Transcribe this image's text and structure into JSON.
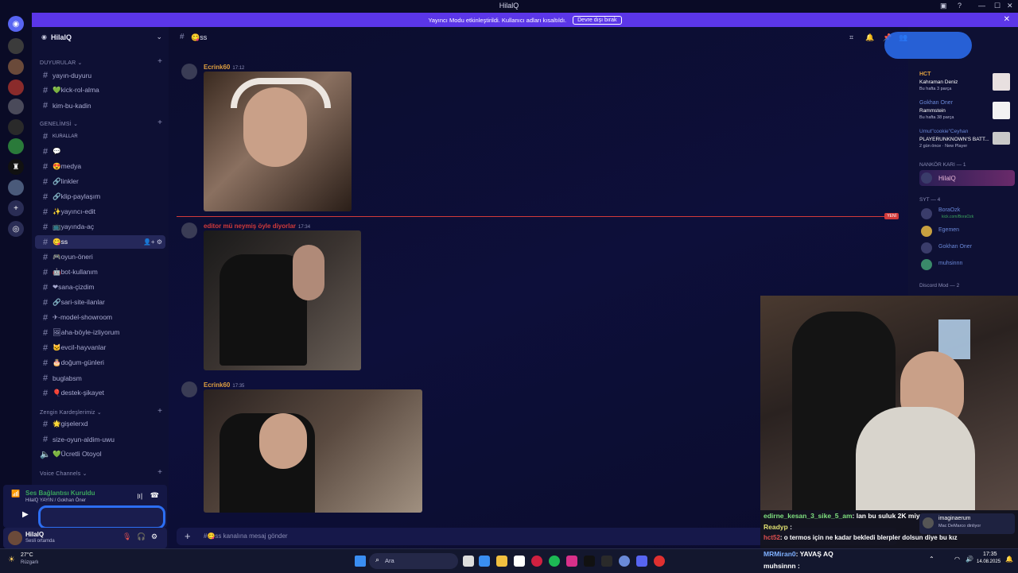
{
  "window": {
    "title": "HilalQ"
  },
  "banner": {
    "text": "Yayıncı Modu etkinleştirildi. Kullanıcı adları kısaltıldı.",
    "button": "Devre dışı bırak"
  },
  "server": {
    "name": "HilalQ"
  },
  "sidebar": {
    "categories": [
      {
        "label": "DUYURULAR ⌄"
      },
      {
        "label": "GENELİMSİ ⌄"
      },
      {
        "label": "Zengin Kardeşlerimiz ⌄"
      },
      {
        "label": "Voice Channels ⌄"
      }
    ],
    "channels": [
      {
        "label": "yayın-duyuru"
      },
      {
        "label": "💚kick-rol-alma"
      },
      {
        "label": "kim-bu-kadin"
      },
      {
        "label": "KURALLAR"
      },
      {
        "label": "💬"
      },
      {
        "label": "😍medya"
      },
      {
        "label": "🔗linkler"
      },
      {
        "label": "🔗klip-paylaşım"
      },
      {
        "label": "✨yayıncı-edit"
      },
      {
        "label": "📺yayında-aç"
      },
      {
        "label": "😋ss"
      },
      {
        "label": "🎮oyun-öneri"
      },
      {
        "label": "🤖bot-kullanım"
      },
      {
        "label": "❤sana-çizdim"
      },
      {
        "label": "🔗sari-site-ilanlar"
      },
      {
        "label": "✈-model-showroom"
      },
      {
        "label": "🖼aha-böyle-izliyorum"
      },
      {
        "label": "🐱evcil-hayvanlar"
      },
      {
        "label": "🎂doğum-günleri"
      },
      {
        "label": "buglabsm"
      },
      {
        "label": "🎈destek-şikayet"
      },
      {
        "label": "🌟gişelerxd"
      },
      {
        "label": "size-oyun-aldim-uwu"
      },
      {
        "label": "💚Ücretli Otoyol"
      }
    ]
  },
  "voice": {
    "status": "Ses Bağlantısı Kuruldu",
    "channel": "HilalQ YAYIN / Gokhan Öner"
  },
  "user": {
    "name": "HilalQ",
    "status": "Sesli ortamda"
  },
  "chat": {
    "channel_title": "😋ss",
    "messages": [
      {
        "author": "Ecrink60",
        "time": "17:12",
        "color": "#e0a040"
      },
      {
        "author": "editor mü neymiş öyle diyorlar",
        "time": "17:34",
        "color": "#d23a3a"
      },
      {
        "author": "Ecrink60",
        "time": "17:35",
        "color": "#e0a040"
      }
    ],
    "new_badge": "YENİ",
    "composer_placeholder": "#😋ss kanalına mesaj gönder"
  },
  "members": {
    "groups": [
      {
        "title": "NANKÖR KARI — 1"
      },
      {
        "title": "SYT — 4"
      },
      {
        "title": "Discord Mod — 2"
      }
    ],
    "activity": [
      {
        "name": "HCT",
        "line1": "Kahraman Deniz",
        "line2": "Bu hafta 3 parça"
      },
      {
        "name": "Gokhan Oner",
        "line1": "Rammstein",
        "line2": "Bu hafta 38 parça"
      },
      {
        "name": "Umut\"cookie\"Ceyhan",
        "line1": "PLAYERUNKNOWN'S BATT...",
        "line2": "2 gün önce · New Player"
      }
    ],
    "users": [
      {
        "name": "HilalQ"
      },
      {
        "name": "BoraOzk",
        "sub": "kick.com/BoraOzk"
      },
      {
        "name": "Egemen"
      },
      {
        "name": "Gokhan Oner"
      },
      {
        "name": "muhsinnn"
      }
    ]
  },
  "stream_chat": [
    {
      "user": "edirne_kesan_3_sike_5_am",
      "text": ": lan bu suluk 2K miydi",
      "color": "#7fe07f"
    },
    {
      "user": "Readyp",
      "text": " :",
      "color": "#e0e070"
    },
    {
      "user": "hct52",
      "text": ": o termos için ne kadar bekledi blerpler dolsun diye bu kız",
      "color": "#e05050"
    },
    {
      "user": "MRMiran0",
      "text": ": YAVAŞ AQ",
      "color": "#7fb0ff"
    },
    {
      "user": "muhsinnn",
      "text": " :",
      "color": "#ffffff"
    }
  ],
  "stream_side": {
    "user": "imaginaerum",
    "text": "Mac DeMarco dinliyor"
  },
  "taskbar": {
    "weather_temp": "27°C",
    "weather_desc": "Rüzgarlı",
    "search": "Ara",
    "time": "17:35",
    "date": "14.08.2025"
  }
}
